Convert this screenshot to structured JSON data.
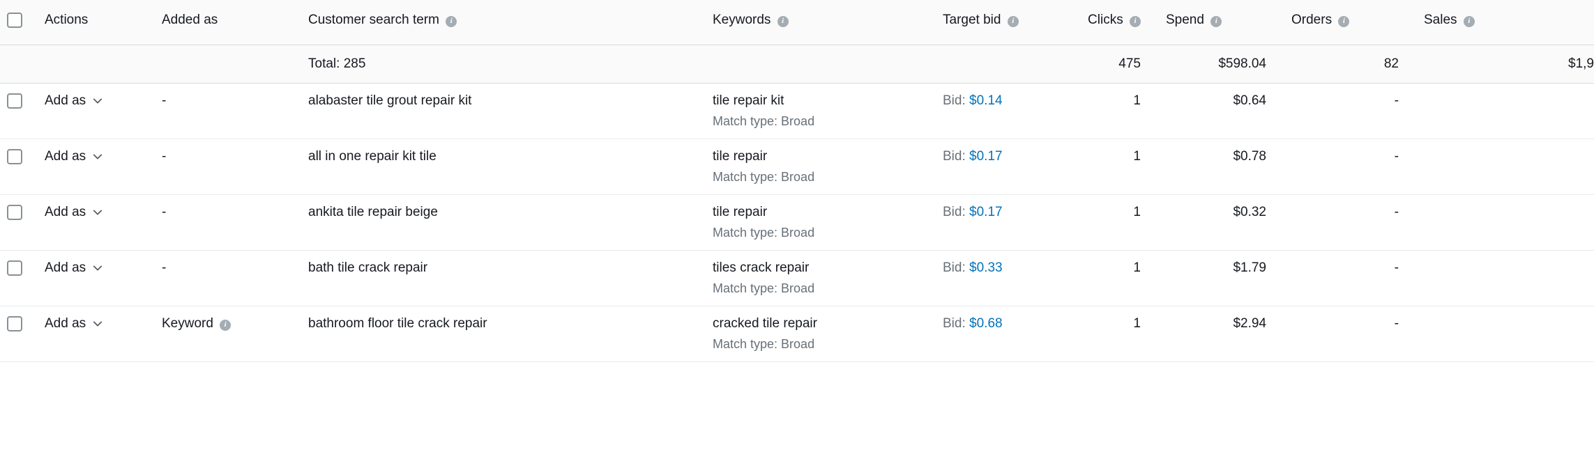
{
  "headers": {
    "actions": "Actions",
    "added_as": "Added as",
    "customer_search_term": "Customer search term",
    "keywords": "Keywords",
    "target_bid": "Target bid",
    "clicks": "Clicks",
    "spend": "Spend",
    "orders": "Orders",
    "sales": "Sales"
  },
  "totals": {
    "label": "Total: 285",
    "clicks": "475",
    "spend": "$598.04",
    "orders": "82",
    "sales": "$1,9"
  },
  "common": {
    "add_as": "Add as",
    "bid_prefix": "Bid: ",
    "match_type_prefix": "Match type: ",
    "dash": "-"
  },
  "rows": [
    {
      "added_as": "-",
      "added_as_info": false,
      "search_term": "alabaster tile grout repair kit",
      "keyword": "tile repair kit",
      "match_type": "Broad",
      "bid": "$0.14",
      "clicks": "1",
      "spend": "$0.64",
      "orders": "-",
      "sales": ""
    },
    {
      "added_as": "-",
      "added_as_info": false,
      "search_term": "all in one repair kit tile",
      "keyword": "tile repair",
      "match_type": "Broad",
      "bid": "$0.17",
      "clicks": "1",
      "spend": "$0.78",
      "orders": "-",
      "sales": ""
    },
    {
      "added_as": "-",
      "added_as_info": false,
      "search_term": "ankita tile repair beige",
      "keyword": "tile repair",
      "match_type": "Broad",
      "bid": "$0.17",
      "clicks": "1",
      "spend": "$0.32",
      "orders": "-",
      "sales": ""
    },
    {
      "added_as": "-",
      "added_as_info": false,
      "search_term": "bath tile crack repair",
      "keyword": "tiles crack repair",
      "match_type": "Broad",
      "bid": "$0.33",
      "clicks": "1",
      "spend": "$1.79",
      "orders": "-",
      "sales": ""
    },
    {
      "added_as": "Keyword",
      "added_as_info": true,
      "search_term": "bathroom floor tile crack repair",
      "keyword": "cracked tile repair",
      "match_type": "Broad",
      "bid": "$0.68",
      "clicks": "1",
      "spend": "$2.94",
      "orders": "-",
      "sales": ""
    }
  ]
}
